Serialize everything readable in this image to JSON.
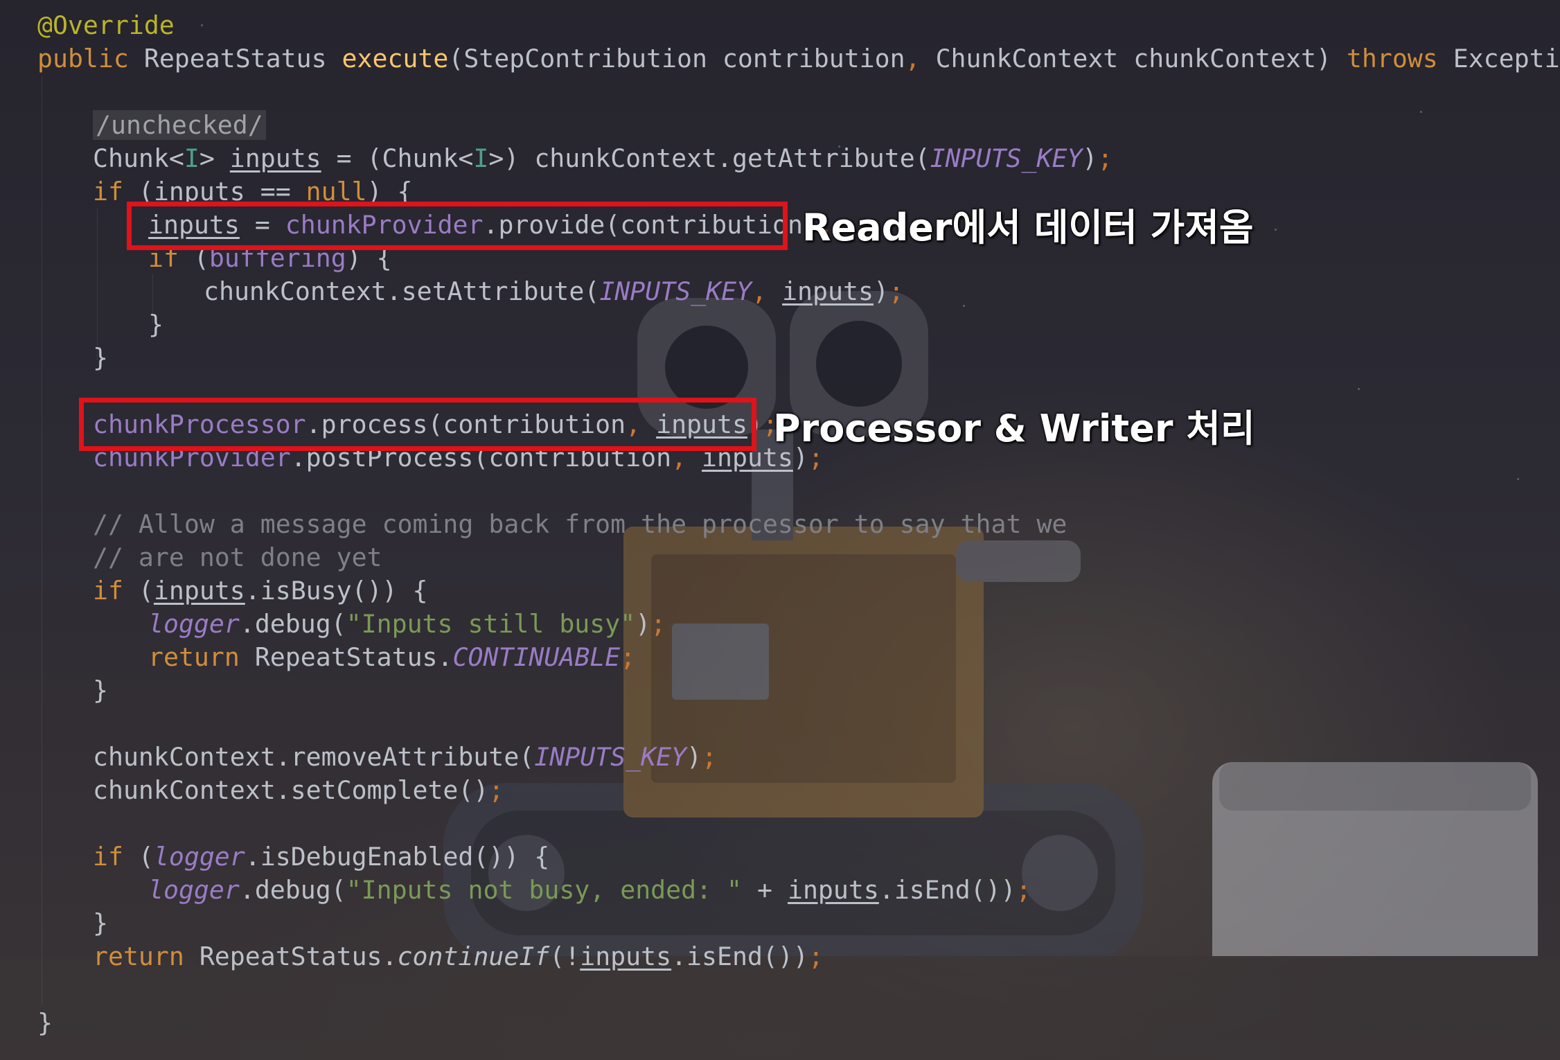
{
  "code": {
    "line1": {
      "annotation": "@Override"
    },
    "line2": {
      "kw_public": "public",
      "ret_type": "RepeatStatus",
      "method": "execute",
      "paren_open": "(StepContribution contribution",
      "comma": ",",
      "param2": " ChunkContext chunkContext) ",
      "kw_throws": "throws",
      "tail": " Exception {"
    },
    "line3": {
      "suppress": "/unchecked/"
    },
    "line4": {
      "chunk1": "Chunk<",
      "gen1": "I",
      "chunk1_end": "> ",
      "var_inputs": "inputs",
      "mid": " = (Chunk<",
      "gen2": "I",
      "mid2": ">) chunkContext.getAttribute(",
      "const": "INPUTS_KEY",
      "end": ")",
      "semi": ";"
    },
    "line5": {
      "kw_if": "if",
      "open": " (",
      "var": "inputs",
      "op": " == ",
      "kw_null": "null",
      "close": ") {"
    },
    "line6": {
      "var": "inputs",
      "eq": " = ",
      "field": "chunkProvider",
      "call": ".provide(contribution)",
      "semi": ";"
    },
    "line7": {
      "kw_if": "if",
      "open": " (",
      "field": "buffering",
      "close": ") {"
    },
    "line8": {
      "call": "chunkContext.setAttribute(",
      "const": "INPUTS_KEY",
      "comma": ",",
      "sp": " ",
      "var": "inputs",
      "end": ")",
      "semi": ";"
    },
    "line9": {
      "brace": "}"
    },
    "line10": {
      "brace": "}"
    },
    "line11": {
      "field": "chunkProcessor",
      "call": ".process(contribution",
      "comma": ",",
      "sp": " ",
      "var": "inputs",
      "end": ")",
      "semi": ";"
    },
    "line12": {
      "field": "chunkProvider",
      "call": ".postProcess(contribution",
      "comma": ",",
      "sp": " ",
      "var": "inputs",
      "end": ")",
      "semi": ";"
    },
    "line13": {
      "comment": "// Allow a message coming back from the processor to say that we"
    },
    "line14": {
      "comment": "// are not done yet"
    },
    "line15": {
      "kw_if": "if",
      "open": " (",
      "var": "inputs",
      "call": ".isBusy()) {"
    },
    "line16": {
      "logger": "logger",
      "call": ".debug(",
      "str": "\"Inputs still busy\"",
      "end": ")",
      "semi": ";"
    },
    "line17": {
      "kw_return": "return",
      "mid": " RepeatStatus.",
      "const": "CONTINUABLE",
      "semi": ";"
    },
    "line18": {
      "brace": "}"
    },
    "line19": {
      "call": "chunkContext.removeAttribute(",
      "const": "INPUTS_KEY",
      "end": ")",
      "semi": ";"
    },
    "line20": {
      "call": "chunkContext.setComplete()",
      "semi": ";"
    },
    "line21": {
      "kw_if": "if",
      "open": " (",
      "logger": "logger",
      "call": ".isDebugEnabled()) {"
    },
    "line22": {
      "logger": "logger",
      "call": ".debug(",
      "str": "\"Inputs not busy, ended: \"",
      "plus": " + ",
      "var": "inputs",
      "end": ".isEnd())",
      "semi": ";"
    },
    "line23": {
      "brace": "}"
    },
    "line24": {
      "kw_return": "return",
      "mid": " RepeatStatus.",
      "static": "continueIf",
      "open": "(!",
      "var": "inputs",
      "end": ".isEnd())",
      "semi": ";"
    },
    "line25": {
      "brace": "}"
    }
  },
  "annotations": {
    "reader_label": "Reader에서 데이터 가져옴",
    "processor_label": "Processor & Writer 처리"
  },
  "colors": {
    "highlight_box": "#e0121a",
    "keyword": "#d08e3c",
    "method": "#ffc66d",
    "field": "#9a7cc5",
    "string": "#7a9a55",
    "comment": "#7f8087",
    "annotation": "#bbb529"
  }
}
